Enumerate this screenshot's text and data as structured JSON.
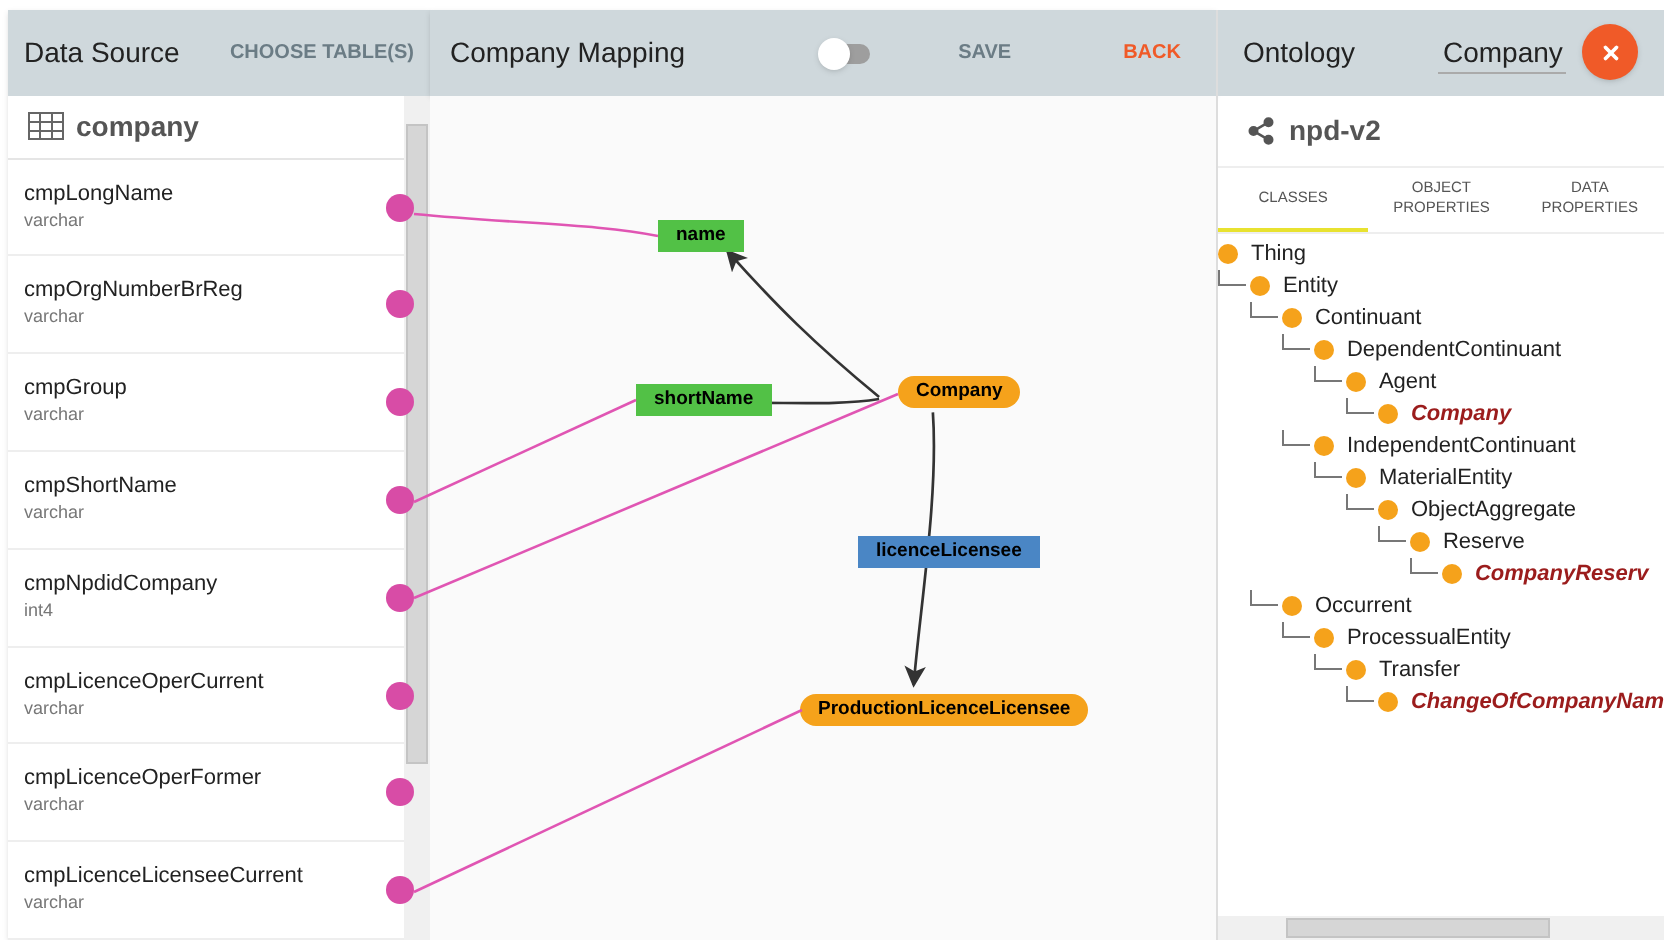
{
  "data_source": {
    "title": "Data Source",
    "action": "CHOOSE TABLE(S)",
    "table": "company",
    "columns": [
      {
        "name": "cmpLongName",
        "type": "varchar",
        "linked": true
      },
      {
        "name": "cmpOrgNumberBrReg",
        "type": "varchar",
        "linked": false
      },
      {
        "name": "cmpGroup",
        "type": "varchar",
        "linked": false
      },
      {
        "name": "cmpShortName",
        "type": "varchar",
        "linked": true
      },
      {
        "name": "cmpNpdidCompany",
        "type": "int4",
        "linked": true
      },
      {
        "name": "cmpLicenceOperCurrent",
        "type": "varchar",
        "linked": false
      },
      {
        "name": "cmpLicenceOperFormer",
        "type": "varchar",
        "linked": false
      },
      {
        "name": "cmpLicenceLicenseeCurrent",
        "type": "varchar",
        "linked": true
      }
    ]
  },
  "mapping": {
    "title": "Company Mapping",
    "toggle": {
      "on": false
    },
    "buttons": [
      {
        "label": "SAVE",
        "kind": "plain"
      },
      {
        "label": "BACK",
        "kind": "accent"
      }
    ],
    "nodes": [
      {
        "label": "name",
        "kind": "property"
      },
      {
        "label": "shortName",
        "kind": "property"
      },
      {
        "label": "Company",
        "kind": "class"
      },
      {
        "label": "licenceLicensee",
        "kind": "relation"
      },
      {
        "label": "ProductionLicenceLicensee",
        "kind": "class"
      }
    ]
  },
  "ontology": {
    "title": "Ontology",
    "class_field": {
      "value": "Company"
    },
    "name": "npd-v2",
    "tabs": [
      {
        "label": "CLASSES",
        "selected": true
      },
      {
        "label": "OBJECT PROPERTIES",
        "selected": false
      },
      {
        "label": "DATA PROPERTIES",
        "selected": false
      }
    ],
    "tree": [
      {
        "label": "Thing",
        "matched": false,
        "children": [
          {
            "label": "Entity",
            "matched": false,
            "children": [
              {
                "label": "Continuant",
                "matched": false,
                "children": [
                  {
                    "label": "DependentContinuant",
                    "matched": false,
                    "children": [
                      {
                        "label": "Agent",
                        "matched": false,
                        "children": [
                          {
                            "label": "Company",
                            "matched": true
                          }
                        ]
                      }
                    ]
                  },
                  {
                    "label": "IndependentContinuant",
                    "matched": false,
                    "children": [
                      {
                        "label": "MaterialEntity",
                        "matched": false,
                        "children": [
                          {
                            "label": "ObjectAggregate",
                            "matched": false,
                            "children": [
                              {
                                "label": "Reserve",
                                "matched": false,
                                "children": [
                                  {
                                    "label": "CompanyReserv",
                                    "matched": true
                                  }
                                ]
                              }
                            ]
                          }
                        ]
                      }
                    ]
                  }
                ]
              },
              {
                "label": "Occurrent",
                "matched": false,
                "children": [
                  {
                    "label": "ProcessualEntity",
                    "matched": false,
                    "children": [
                      {
                        "label": "Transfer",
                        "matched": false,
                        "children": [
                          {
                            "label": "ChangeOfCompanyNam",
                            "matched": true
                          }
                        ]
                      }
                    ]
                  }
                ]
              }
            ]
          }
        ]
      }
    ]
  }
}
